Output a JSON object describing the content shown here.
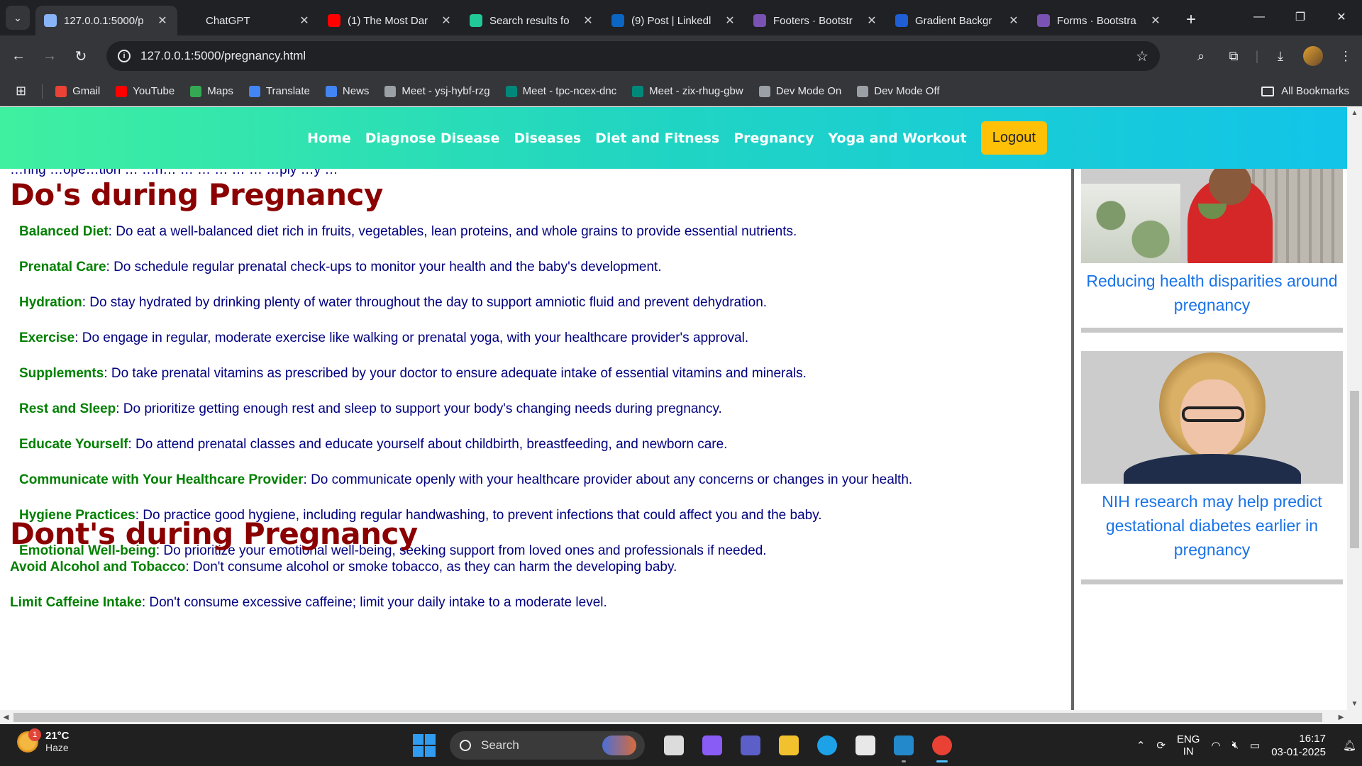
{
  "browser": {
    "tabs": [
      {
        "title": "127.0.0.1:5000/p",
        "icon": "globe-icon",
        "color": "#8ab4f8",
        "active": true
      },
      {
        "title": "ChatGPT",
        "icon": "openai-icon",
        "color": "#202124"
      },
      {
        "title": "(1) The Most Dar",
        "icon": "youtube-icon",
        "color": "#ff0000"
      },
      {
        "title": "Search results fo",
        "icon": "v-check-icon",
        "color": "#20c997"
      },
      {
        "title": "(9) Post | Linkedl",
        "icon": "linkedin-icon",
        "color": "#0a66c2"
      },
      {
        "title": "Footers · Bootstr",
        "icon": "bootstrap-icon",
        "color": "#7952b3"
      },
      {
        "title": "Gradient Backgr",
        "icon": "gradient-icon",
        "color": "#1e5fd6"
      },
      {
        "title": "Forms · Bootstra",
        "icon": "bootstrap-icon",
        "color": "#7952b3"
      }
    ],
    "url": "127.0.0.1:5000/pregnancy.html",
    "bookmarks": [
      {
        "label": "Gmail",
        "icon": "gmail-icon",
        "color": "#ea4335"
      },
      {
        "label": "YouTube",
        "icon": "youtube-icon",
        "color": "#ff0000"
      },
      {
        "label": "Maps",
        "icon": "maps-icon",
        "color": "#34a853"
      },
      {
        "label": "Translate",
        "icon": "translate-icon",
        "color": "#4285f4"
      },
      {
        "label": "News",
        "icon": "news-icon",
        "color": "#4285f4"
      },
      {
        "label": "Meet - ysj-hybf-rzg",
        "icon": "globe-icon",
        "color": "#9aa0a6"
      },
      {
        "label": "Meet - tpc-ncex-dnc",
        "icon": "meet-icon",
        "color": "#00897b"
      },
      {
        "label": "Meet - zix-rhug-gbw",
        "icon": "meet-icon",
        "color": "#00897b"
      },
      {
        "label": "Dev Mode On",
        "icon": "globe-icon",
        "color": "#9aa0a6"
      },
      {
        "label": "Dev Mode Off",
        "icon": "globe-icon",
        "color": "#9aa0a6"
      }
    ],
    "all_bookmarks": "All Bookmarks"
  },
  "nav": {
    "links": [
      "Home",
      "Diagnose Disease",
      "Diseases",
      "Diet and Fitness",
      "Pregnancy",
      "Yoga and Workout"
    ],
    "logout": "Logout"
  },
  "content": {
    "partial_line": "…ring …ope…tion … …h… … … … … … …ply …y …",
    "dos_heading": "Do's during Pregnancy",
    "dos": [
      {
        "term": "Balanced Diet",
        "text": ": Do eat a well-balanced diet rich in fruits, vegetables, lean proteins, and whole grains to provide essential nutrients."
      },
      {
        "term": "Prenatal Care",
        "text": ": Do schedule regular prenatal check-ups to monitor your health and the baby's development."
      },
      {
        "term": "Hydration",
        "text": ": Do stay hydrated by drinking plenty of water throughout the day to support amniotic fluid and prevent dehydration."
      },
      {
        "term": "Exercise",
        "text": ": Do engage in regular, moderate exercise like walking or prenatal yoga, with your healthcare provider's approval."
      },
      {
        "term": "Supplements",
        "text": ": Do take prenatal vitamins as prescribed by your doctor to ensure adequate intake of essential vitamins and minerals."
      },
      {
        "term": "Rest and Sleep",
        "text": ": Do prioritize getting enough rest and sleep to support your body's changing needs during pregnancy."
      },
      {
        "term": "Educate Yourself",
        "text": ": Do attend prenatal classes and educate yourself about childbirth, breastfeeding, and newborn care."
      },
      {
        "term": "Communicate with Your Healthcare Provider",
        "text": ": Do communicate openly with your healthcare provider about any concerns or changes in your health."
      },
      {
        "term": "Hygiene Practices",
        "text": ": Do practice good hygiene, including regular handwashing, to prevent infections that could affect you and the baby."
      },
      {
        "term": "Emotional Well-being",
        "text": ": Do prioritize your emotional well-being, seeking support from loved ones and professionals if needed."
      }
    ],
    "donts_heading": "Dont's during Pregnancy",
    "donts": [
      {
        "term": "Avoid Alcohol and Tobacco",
        "text": ": Don't consume alcohol or smoke tobacco, as they can harm the developing baby."
      },
      {
        "term": "Limit Caffeine Intake",
        "text": ": Don't consume excessive caffeine; limit your daily intake to a moderate level."
      }
    ]
  },
  "sidebar": {
    "cards": [
      {
        "caption": "Reducing health disparities around pregnancy",
        "image": "pregnant-woman-eating-salad"
      },
      {
        "caption": "NIH research may help predict gestational diabetes earlier in pregnancy",
        "image": "woman-with-glasses-portrait"
      }
    ]
  },
  "taskbar": {
    "weather_temp": "21°C",
    "weather_desc": "Haze",
    "weather_badge": "1",
    "search_placeholder": "Search",
    "apps": [
      {
        "name": "task-view-icon",
        "color": "#dcdcdc"
      },
      {
        "name": "copilot-icon",
        "color": "#8a5cf6"
      },
      {
        "name": "teams-icon",
        "color": "#5b5fc7"
      },
      {
        "name": "file-explorer-icon",
        "color": "#f2c12e"
      },
      {
        "name": "edge-icon",
        "color": "#1da2e8"
      },
      {
        "name": "store-icon",
        "color": "#e8e8e8"
      },
      {
        "name": "vscode-icon",
        "color": "#2489ca"
      },
      {
        "name": "chrome-icon",
        "color": "#e94235"
      }
    ],
    "lang_top": "ENG",
    "lang_bottom": "IN",
    "time": "16:17",
    "date": "03-01-2025"
  }
}
